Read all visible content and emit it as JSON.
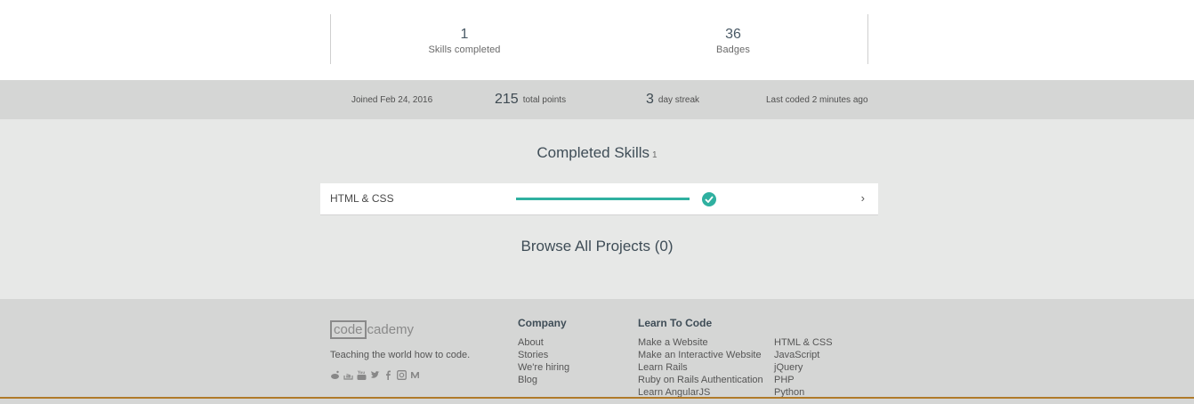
{
  "stats": {
    "skills_completed": {
      "value": "1",
      "label": "Skills completed"
    },
    "badges": {
      "value": "36",
      "label": "Badges"
    }
  },
  "info_bar": {
    "joined": "Joined Feb 24, 2016",
    "points_value": "215",
    "points_label": "total points",
    "streak_value": "3",
    "streak_label": "day streak",
    "last_coded": "Last coded 2 minutes ago"
  },
  "completed_skills": {
    "title": "Completed Skills",
    "count": "1",
    "items": [
      {
        "name": "HTML & CSS",
        "progress": 1.0,
        "arrow": "›"
      }
    ]
  },
  "browse": {
    "title": "Browse All Projects (0)"
  },
  "footer": {
    "logo_box": "code",
    "logo_rest": "cademy",
    "tagline": "Teaching the world how to code.",
    "company_heading": "Company",
    "company_links": [
      "About",
      "Stories",
      "We're hiring",
      "Blog"
    ],
    "learn_heading": "Learn To Code",
    "learn_links_col1": [
      "Make a Website",
      "Make an Interactive Website",
      "Learn Rails",
      "Ruby on Rails Authentication",
      "Learn AngularJS"
    ],
    "learn_links_col2": [
      "HTML & CSS",
      "JavaScript",
      "jQuery",
      "PHP",
      "Python"
    ],
    "social_icons": [
      "reddit-icon",
      "stack-icon",
      "youtube-icon",
      "twitter-icon",
      "facebook-icon",
      "instagram-icon",
      "medium-icon"
    ]
  },
  "colors": {
    "accent": "#2fb0a0",
    "footer_line": "#b07a2a"
  }
}
